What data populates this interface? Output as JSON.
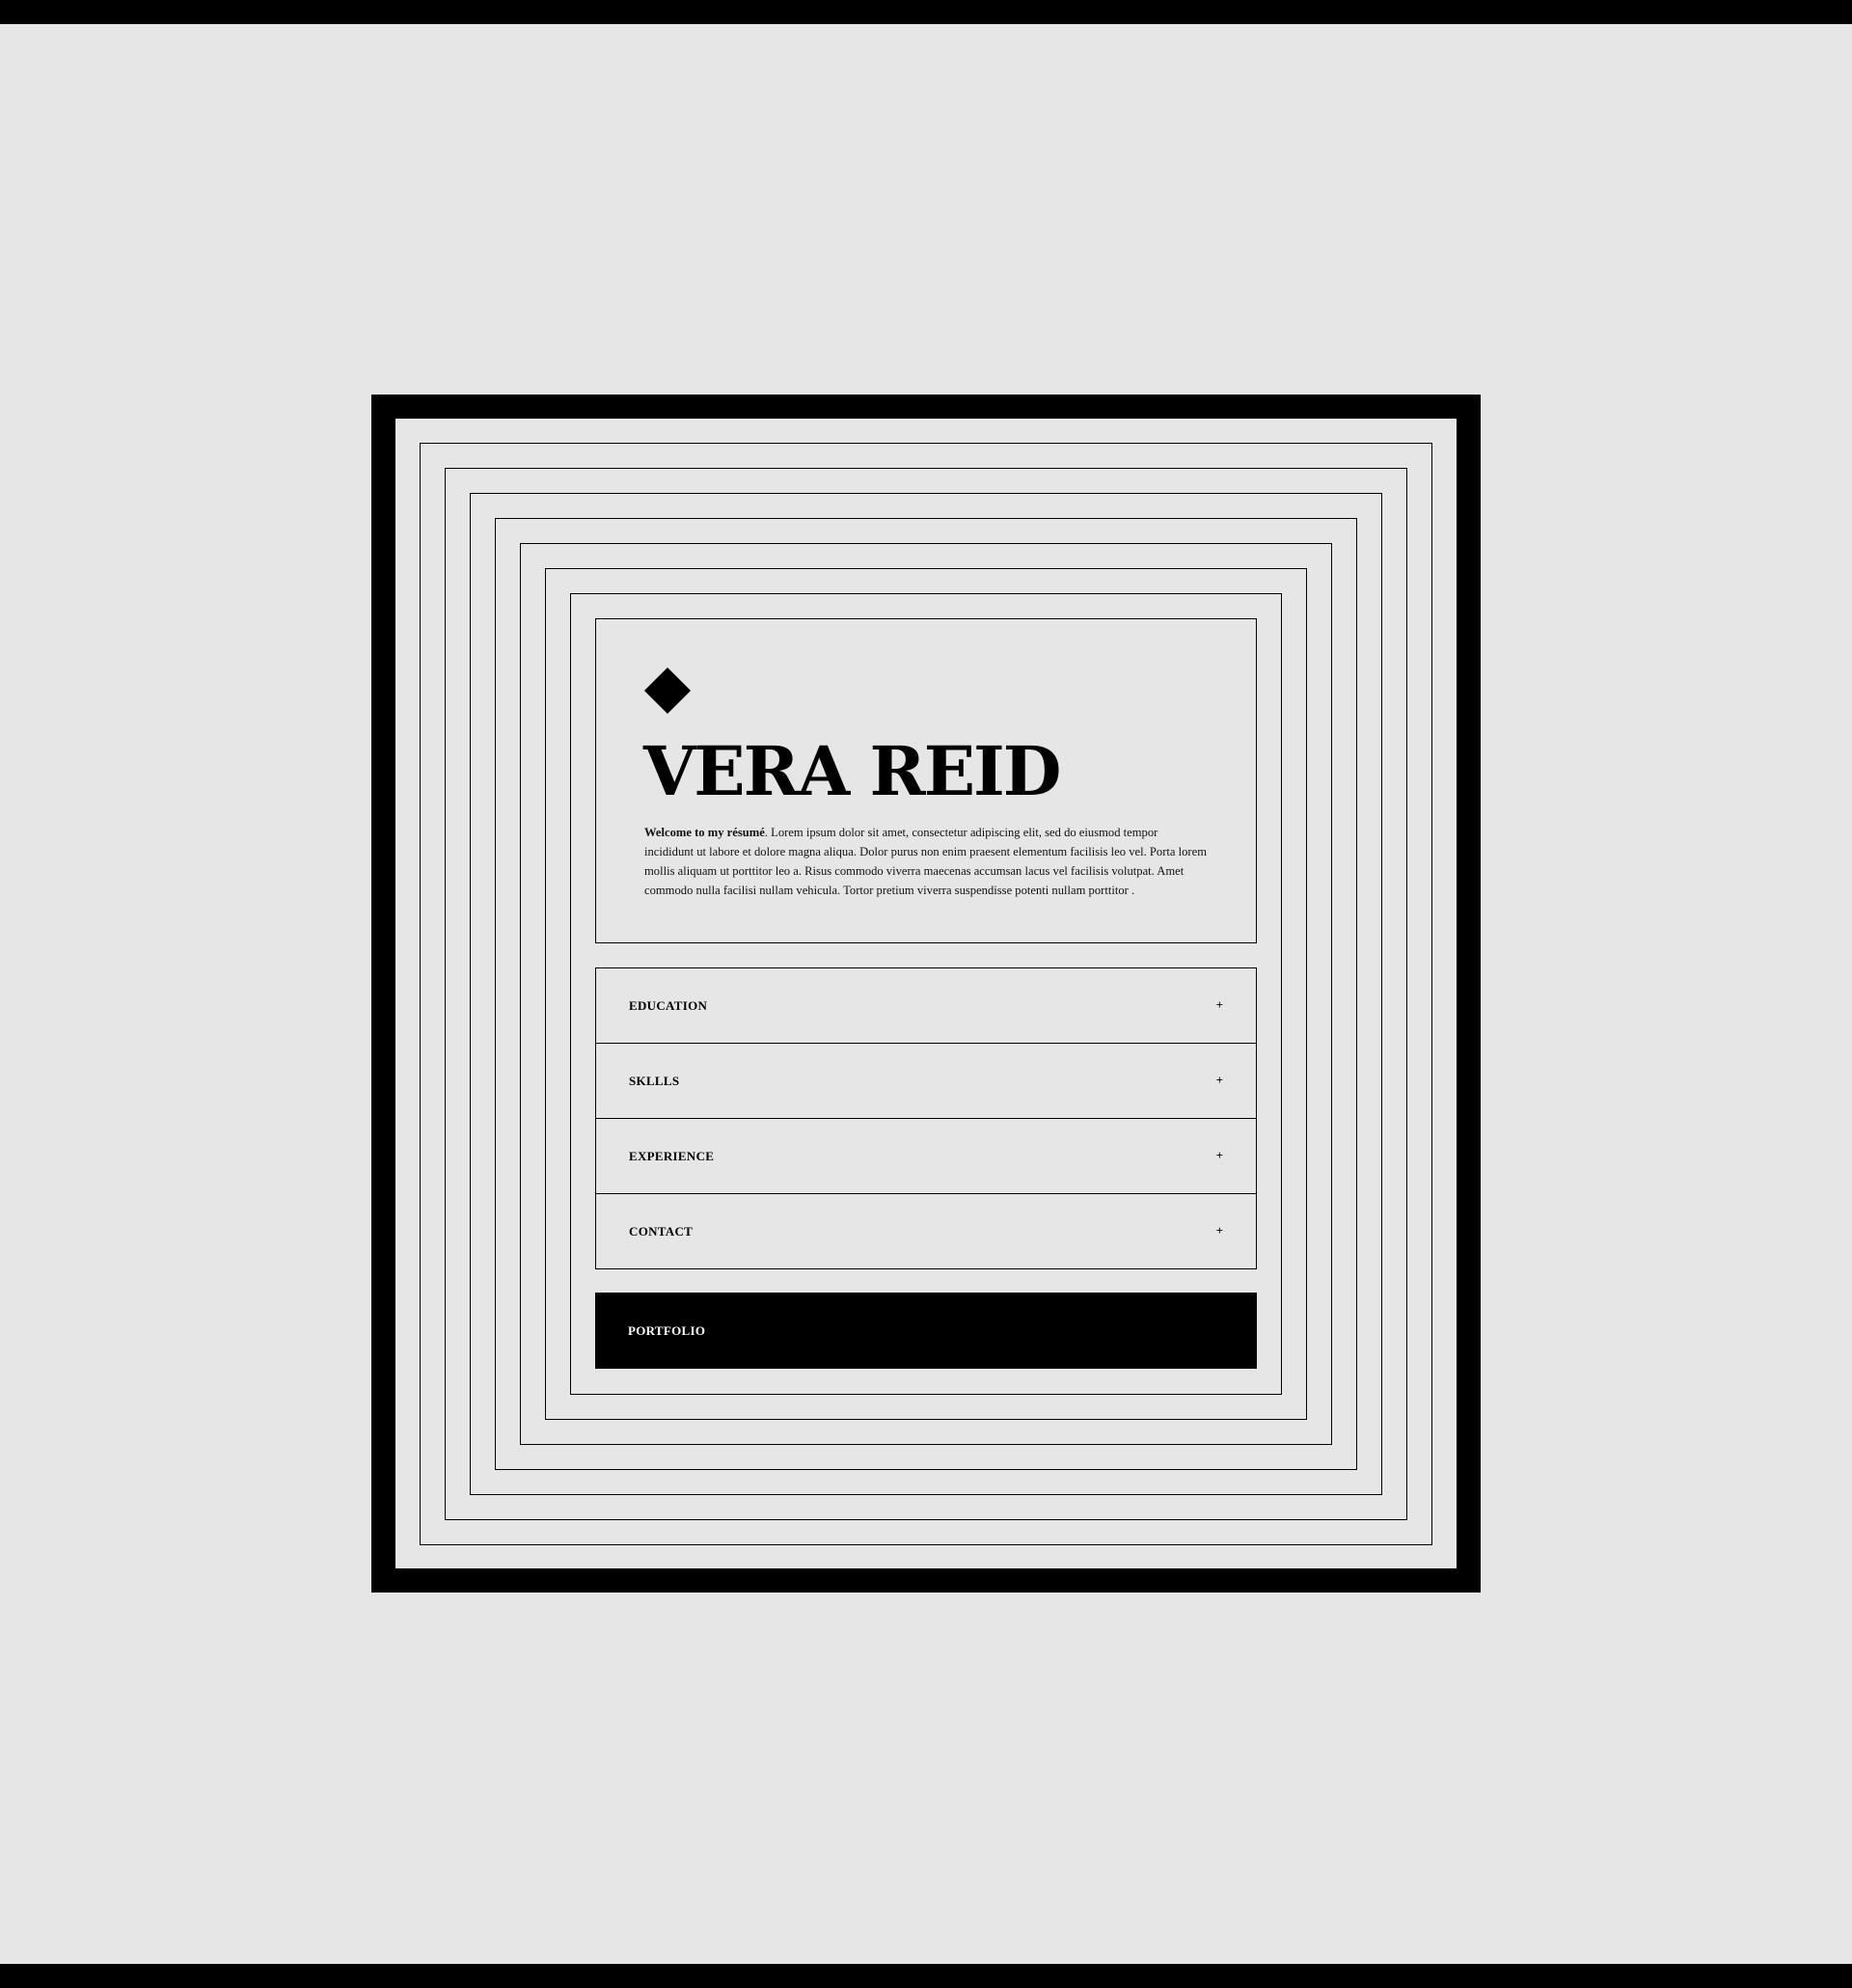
{
  "profile": {
    "name": "VERA REID",
    "intro_lead": "Welcome to my résumé",
    "intro_body": ". Lorem ipsum dolor sit amet, consectetur adipiscing elit, sed do eiusmod tempor incididunt ut labore et dolore magna aliqua. Dolor purus non enim praesent elementum facilisis leo vel. Porta lorem mollis aliquam ut porttitor leo a. Risus commodo viverra maecenas accumsan lacus vel facilisis volutpat. Amet commodo nulla facilisi nullam vehicula. Tortor pretium viverra suspendisse potenti nullam porttitor  ."
  },
  "sections": [
    {
      "label": "EDUCATION",
      "icon": "+"
    },
    {
      "label": "SKLLLS",
      "icon": "+"
    },
    {
      "label": "EXPERIENCE",
      "icon": "+"
    },
    {
      "label": "CONTACT",
      "icon": "+"
    }
  ],
  "portfolio": {
    "label": "PORTFOLIO"
  },
  "colors": {
    "background": "#e6e6e6",
    "ink": "#000000",
    "button_text": "#ffffff"
  },
  "icons": {
    "logo": "diamond-icon",
    "expand": "plus-icon"
  }
}
